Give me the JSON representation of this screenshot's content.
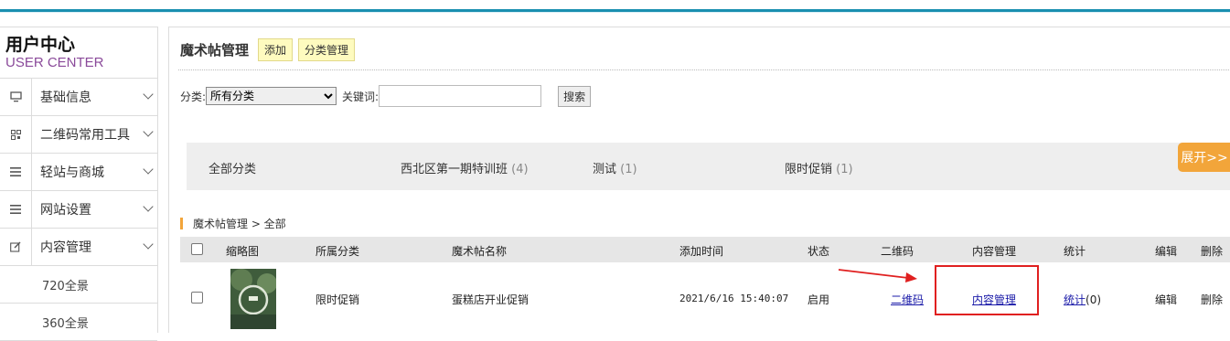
{
  "sidebar": {
    "title_cn": "用户中心",
    "title_en": "USER CENTER",
    "items": [
      {
        "label": "基础信息",
        "icon": "monitor-icon"
      },
      {
        "label": "二维码常用工具",
        "icon": "qrcode-icon"
      },
      {
        "label": "轻站与商城",
        "icon": "menu-icon"
      },
      {
        "label": "网站设置",
        "icon": "menu-icon"
      },
      {
        "label": "内容管理",
        "icon": "edit-icon"
      }
    ],
    "subitems": [
      "720全景",
      "360全景"
    ]
  },
  "main": {
    "title": "魔术帖管理",
    "add_label": "添加",
    "category_manage_label": "分类管理",
    "search": {
      "category_label": "分类:",
      "category_selected": "所有分类",
      "keyword_label": "关键词:",
      "keyword_value": "",
      "search_button": "搜索"
    },
    "categories": [
      {
        "name": "全部分类",
        "count": ""
      },
      {
        "name": "西北区第一期特训班",
        "count": "(4)"
      },
      {
        "name": "测试",
        "count": "(1)"
      },
      {
        "name": "限时促销",
        "count": "(1)"
      }
    ],
    "expand_label": "展开>>",
    "breadcrumb": "魔术帖管理 > 全部",
    "table": {
      "headers": [
        "缩略图",
        "所属分类",
        "魔术帖名称",
        "添加时间",
        "状态",
        "二维码",
        "内容管理",
        "统计",
        "编辑",
        "删除"
      ],
      "rows": [
        {
          "category": "限时促销",
          "name": "蛋糕店开业促销",
          "time": "2021/6/16 15:40:07",
          "status": "启用",
          "qrcode": "二维码",
          "content": "内容管理",
          "stats": "统计",
          "stats_count": "(0)",
          "edit": "编辑",
          "delete": "删除"
        }
      ]
    }
  },
  "colors": {
    "accent": "#1a8fb0",
    "expand": "#f2a53a",
    "highlight": "#e02020",
    "link": "#1a1aa8"
  }
}
